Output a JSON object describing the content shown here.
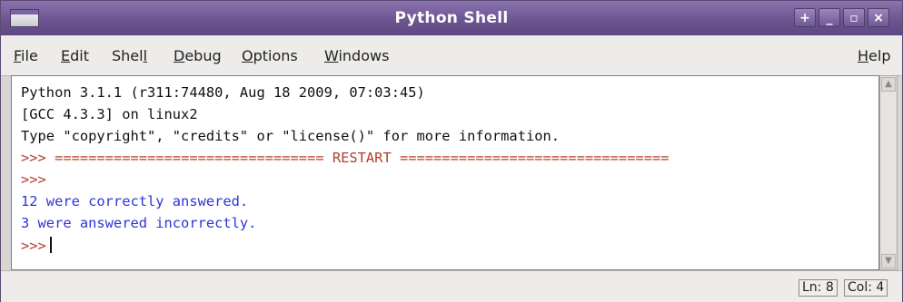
{
  "window": {
    "title": "Python Shell",
    "buttons": {
      "up": "+",
      "minimize": "_",
      "maximize": "▫",
      "close": "×"
    }
  },
  "menubar": {
    "items": [
      {
        "mnemonic": "F",
        "rest": "ile"
      },
      {
        "mnemonic": "E",
        "rest": "dit"
      },
      {
        "mnemonic": "",
        "prefix": "Shel",
        "mnemonic2": "l",
        "rest": ""
      },
      {
        "mnemonic": "D",
        "rest": "ebug"
      },
      {
        "mnemonic": "O",
        "rest": "ptions"
      },
      {
        "mnemonic": "W",
        "rest": "indows"
      }
    ],
    "help": {
      "mnemonic": "H",
      "rest": "elp"
    }
  },
  "shell": {
    "lines": [
      "Python 3.1.1 (r311:74480, Aug 18 2009, 07:03:45)",
      "[GCC 4.3.3] on linux2",
      "Type \"copyright\", \"credits\" or \"license()\" for more information."
    ],
    "restart_prompt": ">>>",
    "restart_text": " ================================ RESTART ================================",
    "prompt2": ">>>",
    "output_lines": [
      "12 were correctly answered.",
      "3 were answered incorrectly."
    ],
    "prompt3": ">>>"
  },
  "status": {
    "line": "Ln: 8",
    "col": "Col: 4"
  }
}
